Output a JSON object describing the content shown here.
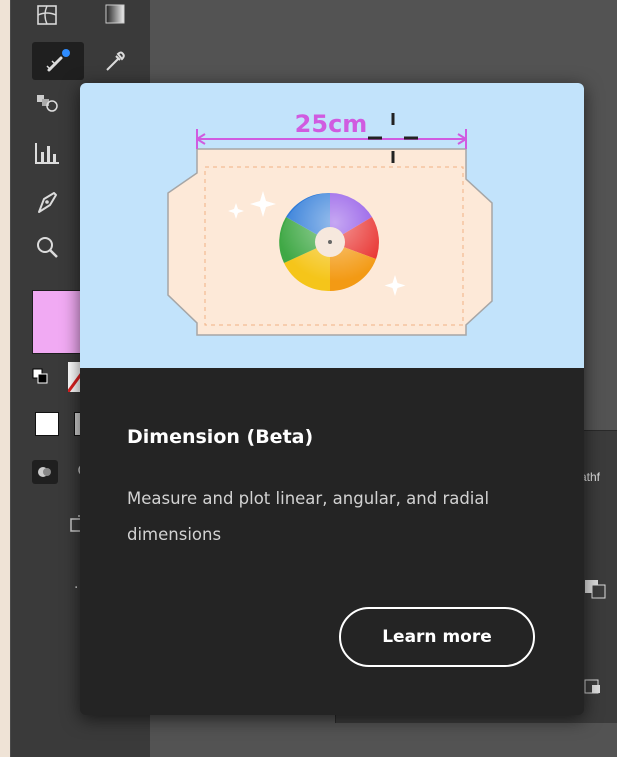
{
  "popover": {
    "title": "Dimension (Beta)",
    "description": "Measure and plot linear, angular, and radial dimensions",
    "learn_more_label": "Learn more",
    "illustration": {
      "measurement_label": "25cm",
      "background_color": "#c2e3fb",
      "artboard_color": "#fde9d8",
      "dimension_color": "#d05be0"
    }
  },
  "toolbar": {
    "tools": [
      {
        "icon": "mesh-icon"
      },
      {
        "icon": "gradient-icon"
      },
      {
        "icon": "dimension-tool-icon",
        "selected": true
      },
      {
        "icon": "eyedropper-icon"
      },
      {
        "icon": "blend-icon"
      },
      {
        "icon": "bar-graph-icon"
      },
      {
        "icon": "pen-icon"
      },
      {
        "icon": "zoom-icon"
      }
    ],
    "fill_color": "#f1aaf3",
    "more_label": "..."
  },
  "side_panel": {
    "label": "athf"
  },
  "colors": {
    "popover_bg": "#242424",
    "toolbar_bg": "#3a3a3a",
    "canvas_bg": "#535353"
  }
}
